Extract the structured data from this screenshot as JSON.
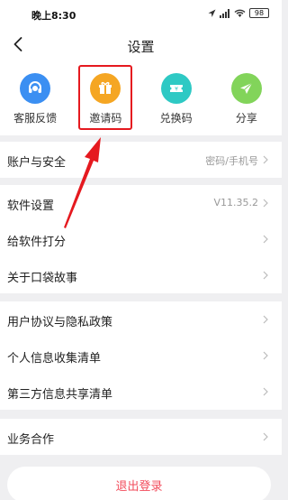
{
  "status_bar": {
    "time": "晚上8:30",
    "battery": "98"
  },
  "header": {
    "title": "设置",
    "back_icon": "back-arrow-icon"
  },
  "shortcuts": [
    {
      "label": "客服反馈",
      "icon": "headset-icon",
      "color": "#3b8ff2"
    },
    {
      "label": "邀请码",
      "icon": "gift-icon",
      "color": "#f5a623"
    },
    {
      "label": "兑换码",
      "icon": "ticket-icon",
      "color": "#2ec9c4"
    },
    {
      "label": "分享",
      "icon": "paper-plane-icon",
      "color": "#82d45a"
    }
  ],
  "account": {
    "label": "账户与安全",
    "value": "密码/手机号"
  },
  "software": [
    {
      "label": "软件设置",
      "value": "V11.35.2"
    },
    {
      "label": "给软件打分",
      "value": ""
    },
    {
      "label": "关于口袋故事",
      "value": ""
    }
  ],
  "policies": [
    {
      "label": "用户协议与隐私政策"
    },
    {
      "label": "个人信息收集清单"
    },
    {
      "label": "第三方信息共享清单"
    }
  ],
  "business": {
    "label": "业务合作"
  },
  "logout": {
    "label": "退出登录"
  },
  "annotation": {
    "highlight_color": "#e5191f"
  }
}
